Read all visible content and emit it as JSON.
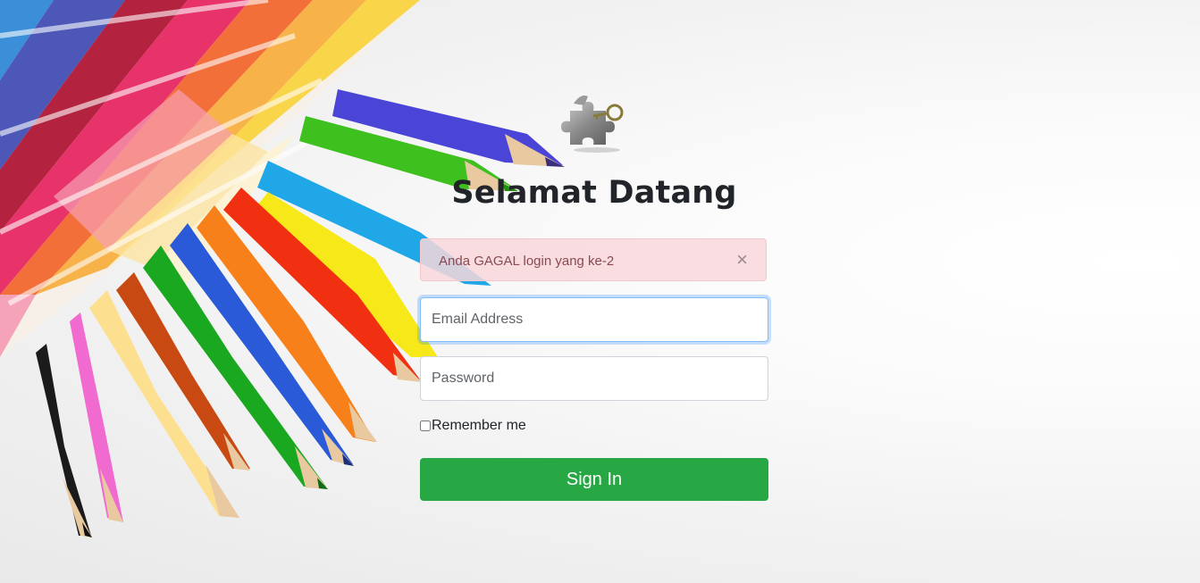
{
  "page": {
    "title": "Selamat Datang"
  },
  "alert": {
    "message": "Anda GAGAL login yang ke-2",
    "close_symbol": "×"
  },
  "form": {
    "email_placeholder": "Email Address",
    "email_value": "",
    "password_placeholder": "Password",
    "password_value": "",
    "remember_label": "Remember me",
    "remember_checked": false,
    "submit_label": "Sign In"
  },
  "icons": {
    "logo": "puzzle-key-icon",
    "close": "close-icon"
  },
  "colors": {
    "primary_button": "#28a745",
    "alert_bg": "#f8d7da",
    "alert_text": "#8a4a52",
    "focus_border": "#80bdff"
  }
}
